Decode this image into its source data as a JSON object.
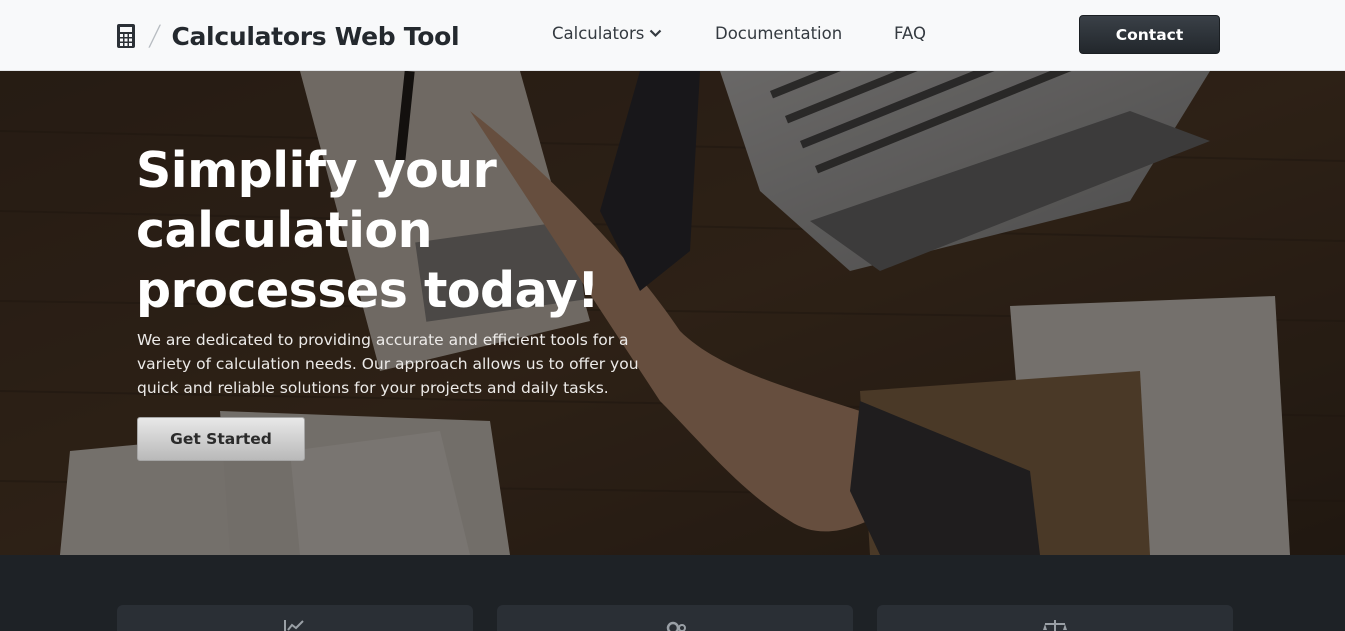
{
  "navbar": {
    "brand_icon": "calculator-icon",
    "brand_name": "Calculators Web Tool",
    "links": {
      "calculators": "Calculators",
      "documentation": "Documentation",
      "faq": "FAQ"
    },
    "contact_label": "Contact"
  },
  "hero": {
    "title": "Simplify your calculation processes today!",
    "description": "We are dedicated to providing accurate and efficient tools for a variety of calculation needs. Our approach allows us to offer you quick and reliable solutions for your projects and daily tasks.",
    "cta_label": "Get Started",
    "background": "handshake-business-desk-photo"
  },
  "features": {
    "cards": [
      {
        "icon": "chart-line-icon"
      },
      {
        "icon": "gear-icon"
      },
      {
        "icon": "balance-scale-icon"
      }
    ]
  },
  "colors": {
    "navbar_bg": "#f8f9fa",
    "contact_btn": "#2b3036",
    "features_bg": "#1e2226",
    "card_bg": "#2a2f35"
  }
}
